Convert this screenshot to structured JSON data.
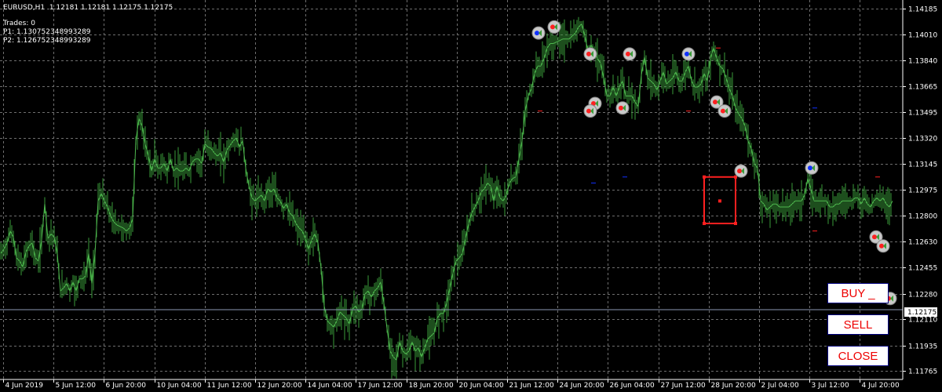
{
  "header": {
    "symbol_line": "EURUSD,H1  1.12181 1.12181 1.12175 1.12175",
    "trades": "Trades: 0",
    "p1": "P1: 1.130752348993289",
    "p2": "P2: 1.126752348993289"
  },
  "buttons": {
    "buy": "BUY _",
    "sell": "SELL",
    "close": "CLOSE"
  },
  "colors": {
    "background": "#000000",
    "grid": "#6e6e6e",
    "candles": "#3a9c3a",
    "rect": "#ff2020",
    "bid_line": "#8c97b4",
    "buy_arrow": "#1030ff",
    "sell_arrow": "#ff2020"
  },
  "chart_data": {
    "type": "line",
    "symbol": "EURUSD",
    "timeframe": "H1",
    "current_price": "1.12175",
    "y_ticks": [
      "1.14185",
      "1.14010",
      "1.13840",
      "1.13665",
      "1.13495",
      "1.13320",
      "1.13145",
      "1.12975",
      "1.12800",
      "1.12630",
      "1.12455",
      "1.12280",
      "1.12110",
      "1.11935",
      "1.11765"
    ],
    "x_ticks": [
      "4 Jun 2019",
      "5 Jun 12:00",
      "6 Jun 20:00",
      "10 Jun 04:00",
      "11 Jun 12:00",
      "12 Jun 20:00",
      "14 Jun 04:00",
      "17 Jun 12:00",
      "18 Jun 20:00",
      "20 Jun 04:00",
      "21 Jun 12:00",
      "24 Jun 20:00",
      "26 Jun 04:00",
      "27 Jun 12:00",
      "28 Jun 20:00",
      "2 Jul 04:00",
      "3 Jul 12:00",
      "4 Jul 20:00"
    ],
    "ylim": [
      1.1171,
      1.1424
    ],
    "x": [
      0,
      4,
      8,
      12,
      16,
      20,
      24,
      28,
      32,
      36,
      40,
      44,
      48,
      52,
      56,
      60,
      64,
      68,
      72,
      76,
      80,
      84,
      88,
      92,
      96,
      100,
      104,
      108,
      112,
      116,
      120,
      124,
      128,
      132,
      136,
      140,
      144,
      148,
      152,
      156,
      160,
      164,
      168,
      172,
      176,
      180,
      184,
      188,
      192,
      196,
      200,
      204,
      208,
      212,
      216,
      220,
      224,
      228,
      232,
      236,
      240,
      244,
      248,
      252,
      256,
      260,
      264,
      268,
      272,
      276,
      280,
      284,
      288,
      292,
      296,
      300,
      304,
      308,
      312,
      316,
      320,
      324,
      328,
      332,
      336,
      340,
      344,
      348,
      352,
      356,
      360,
      364,
      368,
      372,
      376,
      380,
      384,
      388,
      392,
      396,
      400,
      404,
      408,
      412,
      416,
      420,
      424,
      428,
      432,
      436,
      440,
      444,
      448,
      452,
      456,
      460,
      464,
      468,
      472,
      476,
      480,
      484,
      488,
      492,
      496,
      500,
      504,
      508,
      512,
      516,
      520,
      524,
      528,
      532,
      536,
      540,
      544,
      548,
      552,
      556,
      560,
      564,
      568,
      572,
      576,
      580,
      584,
      588,
      592,
      596,
      600,
      604,
      608,
      612,
      616,
      620,
      624,
      628,
      632,
      636,
      640,
      644,
      648,
      652,
      656,
      660,
      664,
      668,
      672,
      676,
      680,
      684,
      688,
      692,
      696,
      700,
      704,
      708,
      712,
      716,
      720,
      724,
      728,
      732,
      736,
      740,
      744,
      748,
      752,
      756,
      760,
      764,
      768,
      772,
      776,
      780,
      784,
      788,
      792,
      796,
      800,
      804,
      808,
      812,
      816,
      820,
      824,
      828,
      832,
      836,
      840,
      844,
      848,
      852,
      856,
      860,
      864,
      868,
      872,
      876,
      880,
      884,
      888,
      892,
      896,
      900,
      904,
      908,
      912,
      916,
      920,
      924,
      928,
      932,
      936,
      940,
      944,
      948,
      952,
      956,
      960,
      964,
      968,
      972,
      976,
      980,
      984,
      988,
      992,
      996,
      1000,
      1004,
      1008,
      1012,
      1016,
      1020,
      1024,
      1028,
      1032,
      1036,
      1040,
      1044,
      1048,
      1052,
      1056,
      1060,
      1064,
      1068,
      1072,
      1076,
      1080,
      1084,
      1088,
      1092,
      1096,
      1100,
      1104,
      1108,
      1112,
      1116,
      1120,
      1124,
      1128,
      1132,
      1136
    ],
    "values": [
      1.1255,
      1.1258,
      1.1262,
      1.127,
      1.1266,
      1.1252,
      1.125,
      1.1246,
      1.1256,
      1.126,
      1.1262,
      1.1252,
      1.125,
      1.1264,
      1.1288,
      1.1265,
      1.1268,
      1.1266,
      1.1255,
      1.123,
      1.1232,
      1.1235,
      1.123,
      1.1236,
      1.123,
      1.1238,
      1.1238,
      1.124,
      1.1255,
      1.1235,
      1.1255,
      1.129,
      1.1295,
      1.129,
      1.1286,
      1.128,
      1.1276,
      1.1274,
      1.1273,
      1.1272,
      1.127,
      1.1272,
      1.1278,
      1.133,
      1.1345,
      1.134,
      1.1328,
      1.132,
      1.131,
      1.1318,
      1.1312,
      1.1312,
      1.1315,
      1.131,
      1.1318,
      1.131,
      1.1312,
      1.131,
      1.131,
      1.1312,
      1.131,
      1.1316,
      1.1318,
      1.1318,
      1.1315,
      1.1328,
      1.1326,
      1.1325,
      1.1322,
      1.132,
      1.1322,
      1.1316,
      1.1324,
      1.1327,
      1.133,
      1.1332,
      1.1326,
      1.133,
      1.1312,
      1.13,
      1.1292,
      1.129,
      1.1292,
      1.1294,
      1.129,
      1.1298,
      1.1296,
      1.1298,
      1.1292,
      1.129,
      1.1285,
      1.1288,
      1.1282,
      1.128,
      1.1275,
      1.1272,
      1.127,
      1.1265,
      1.1258,
      1.1264,
      1.1268,
      1.1262,
      1.1245,
      1.122,
      1.121,
      1.1208,
      1.1206,
      1.121,
      1.1216,
      1.1214,
      1.1212,
      1.1208,
      1.1218,
      1.122,
      1.1216,
      1.1218,
      1.1228,
      1.123,
      1.1226,
      1.123,
      1.1232,
      1.1236,
      1.1222,
      1.1205,
      1.119,
      1.1186,
      1.1184,
      1.1196,
      1.119,
      1.1188,
      1.119,
      1.1196,
      1.119,
      1.1192,
      1.1186,
      1.1192,
      1.1198,
      1.12,
      1.1202,
      1.1212,
      1.1215,
      1.1215,
      1.1222,
      1.1232,
      1.1242,
      1.125,
      1.1252,
      1.1255,
      1.1265,
      1.1275,
      1.1282,
      1.1286,
      1.129,
      1.1296,
      1.1298,
      1.1302,
      1.13,
      1.129,
      1.13,
      1.1292,
      1.129,
      1.1294,
      1.1302,
      1.1305,
      1.1306,
      1.1318,
      1.133,
      1.135,
      1.136,
      1.1365,
      1.1375,
      1.138,
      1.138,
      1.1385,
      1.1392,
      1.1395,
      1.1395,
      1.1396,
      1.1397,
      1.1398,
      1.1398,
      1.1398,
      1.14,
      1.1402,
      1.1406,
      1.1408,
      1.14,
      1.139,
      1.1394,
      1.139,
      1.1385,
      1.1382,
      1.1372,
      1.136,
      1.136,
      1.1366,
      1.136,
      1.1366,
      1.137,
      1.136,
      1.136,
      1.136,
      1.1356,
      1.1353,
      1.1374,
      1.1386,
      1.1372,
      1.137,
      1.1368,
      1.1364,
      1.137,
      1.1376,
      1.1368,
      1.137,
      1.1372,
      1.1376,
      1.137,
      1.137,
      1.1376,
      1.138,
      1.137,
      1.1366,
      1.1366,
      1.1368,
      1.1375,
      1.137,
      1.1385,
      1.1392,
      1.1385,
      1.138,
      1.1378,
      1.1372,
      1.1365,
      1.136,
      1.1352,
      1.1348,
      1.1345,
      1.134,
      1.133,
      1.1325,
      1.1315,
      1.1312,
      1.129,
      1.1288,
      1.1284,
      1.1286,
      1.1288,
      1.1288,
      1.1286,
      1.1286,
      1.1286,
      1.1286,
      1.1288,
      1.129,
      1.129,
      1.129,
      1.1294,
      1.1305,
      1.1298,
      1.129,
      1.129,
      1.129,
      1.129,
      1.129,
      1.1286,
      1.1286,
      1.1288,
      1.1288,
      1.129,
      1.129,
      1.129,
      1.129,
      1.1292,
      1.1292,
      1.1288,
      1.1292,
      1.1288,
      1.1286,
      1.129,
      1.1292,
      1.129,
      1.1292,
      1.1288,
      1.1286,
      1.129,
      1.129,
      1.1289,
      1.129,
      1.1285,
      1.1282,
      1.1282,
      1.1286,
      1.1284,
      1.128,
      1.1276,
      1.1272,
      1.1268,
      1.126,
      1.125,
      1.1238,
      1.1225,
      1.1222,
      1.1219,
      1.1218
    ]
  },
  "rectangle": {
    "top": 1.1306,
    "bottom": 1.1275,
    "mid": 1.129
  }
}
